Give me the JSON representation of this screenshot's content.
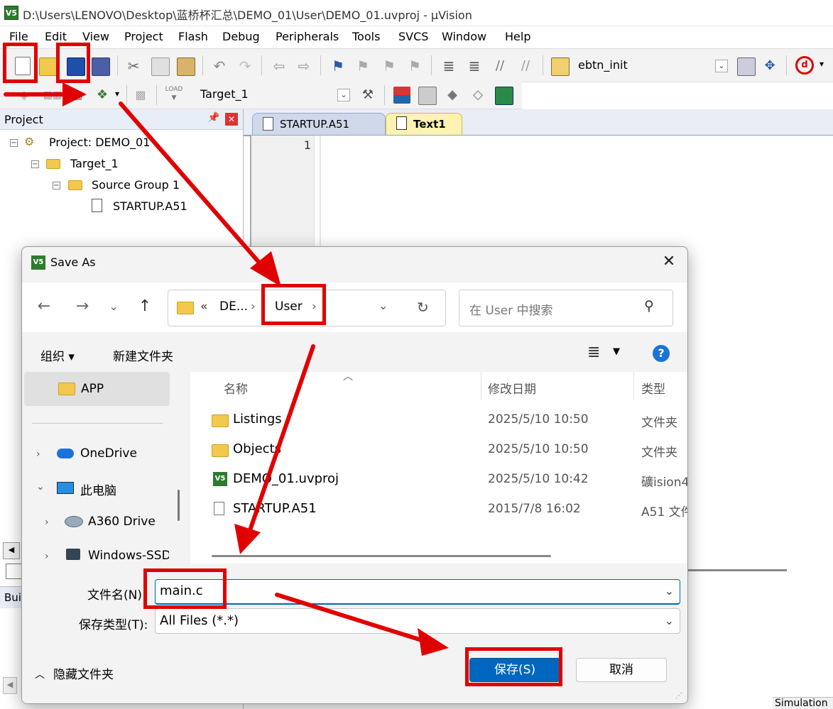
{
  "window": {
    "title": "D:\\Users\\LENOVO\\Desktop\\蓝桥杯汇总\\DEMO_01\\User\\DEMO_01.uvproj - µVision",
    "app_icon_text": "V5"
  },
  "menu": [
    "File",
    "Edit",
    "View",
    "Project",
    "Flash",
    "Debug",
    "Peripherals",
    "Tools",
    "SVCS",
    "Window",
    "Help"
  ],
  "toolbar": {
    "function_combo": "ebtn_init",
    "target_combo": "Target_1"
  },
  "project_pane": {
    "title": "Project",
    "pin_icon": "pin-icon",
    "close_icon": "close-icon",
    "tree": {
      "project": "Project: DEMO_01",
      "target": "Target_1",
      "group": "Source Group 1",
      "file": "STARTUP.A51"
    }
  },
  "editor": {
    "tabs": [
      {
        "label": "STARTUP.A51",
        "active": false
      },
      {
        "label": "Text1",
        "active": true
      }
    ],
    "line_number": "1"
  },
  "background_fragments": {
    "build_label": "Bui",
    "status_text": "Simulation"
  },
  "dialog": {
    "title": "Save As",
    "address": {
      "overflow": "«",
      "crumb1": "DE...",
      "crumb2": "User",
      "sep": "›"
    },
    "search_placeholder": "在 User 中搜索",
    "organize_label": "组织 ▾",
    "new_folder_label": "新建文件夹",
    "columns": {
      "name": "名称",
      "date": "修改日期",
      "type": "类型"
    },
    "files": [
      {
        "name": "Listings",
        "date": "2025/5/10 10:50",
        "type": "文件夹",
        "icon": "folder-icon"
      },
      {
        "name": "Objects",
        "date": "2025/5/10 10:50",
        "type": "文件夹",
        "icon": "folder-icon"
      },
      {
        "name": "DEMO_01.uvproj",
        "date": "2025/5/10 10:42",
        "type": "礦ision4",
        "icon": "uvision-file-icon"
      },
      {
        "name": "STARTUP.A51",
        "date": "2015/7/8 16:02",
        "type": "A51 文件",
        "icon": "document-icon"
      }
    ],
    "sidebar": [
      {
        "label": "APP",
        "icon": "folder-icon",
        "selected": true
      },
      {
        "label": "OneDrive",
        "icon": "cloud-icon"
      },
      {
        "label": "此电脑",
        "icon": "computer-icon"
      },
      {
        "label": "A360 Drive",
        "icon": "a360-drive-icon"
      },
      {
        "label": "Windows-SSD",
        "icon": "drive-icon"
      }
    ],
    "filename_label": "文件名(N):",
    "filename_value": "main.c",
    "filetype_label": "保存类型(T):",
    "filetype_value": "All Files (*.*)",
    "hide_folders_label": "隐藏文件夹",
    "save_label": "保存(S)",
    "cancel_label": "取消"
  },
  "colors": {
    "annotation_red": "#e00000",
    "accent_blue": "#0067c0",
    "folder_yellow": "#f2c94c",
    "uvision_green": "#2d7b2d"
  }
}
